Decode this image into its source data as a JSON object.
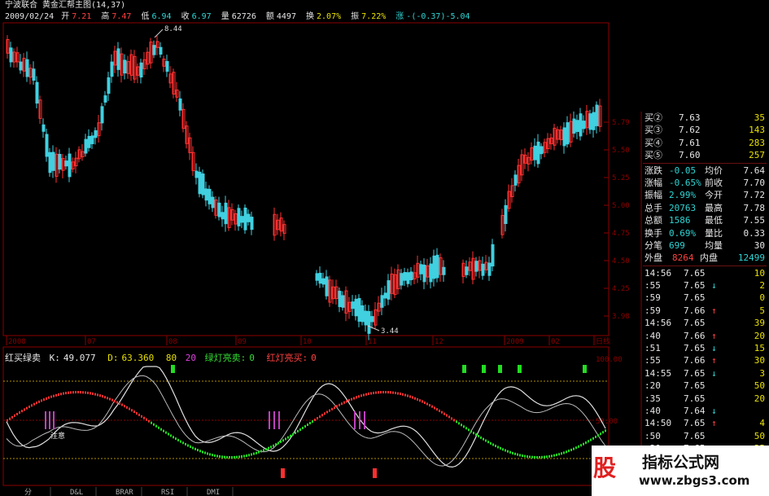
{
  "header": {
    "stock_name": "宁波联合",
    "chart_title": "黄金汇帮主图(14,37)",
    "date": "2009/02/24",
    "open_label": "开",
    "open": "7.21",
    "high_label": "高",
    "high": "7.47",
    "low_label": "低",
    "low": "6.94",
    "close_label": "收",
    "close": "6.97",
    "volume_label": "量",
    "volume": "62726",
    "amount_label": "额",
    "amount": "4497",
    "turnover_label": "换",
    "turnover": "2.07%",
    "amplitude_label": "振",
    "amplitude": "7.22%",
    "change_label": "涨",
    "change": "-(-0.37)-5.04"
  },
  "main_chart": {
    "y_ticks": [
      "5.79",
      "5.50",
      "5.25",
      "5.00",
      "4.75",
      "4.50",
      "4.25",
      "3.98"
    ],
    "high_annotation": "8.44",
    "low_annotation": "3.44",
    "x_ticks": [
      "2008",
      "07",
      "08",
      "09",
      "10",
      "11",
      "12",
      "2009",
      "02",
      "日线"
    ]
  },
  "indicator": {
    "name": "红买绿卖",
    "k_label": "K:",
    "k_value": "49.077",
    "d_label": "D:",
    "d_value": "63.360",
    "v80": "80",
    "v20": "20",
    "green_label": "绿灯亮卖:",
    "green_value": "0",
    "red_label": "红灯亮买:",
    "red_value": "0",
    "y_ticks": [
      "100.00",
      "50.00"
    ],
    "attention": "注意",
    "bottom_tabs": [
      "分",
      "D&L",
      "BRAR",
      "RSI",
      "DMI"
    ]
  },
  "colors": {
    "up": "#ff3030",
    "down": "#40d0e0",
    "grid": "#8b0000",
    "green": "#22dd22",
    "purple": "#c040c0"
  },
  "panel": {
    "bids": [
      {
        "label": "买②",
        "price": "7.63",
        "vol": "35"
      },
      {
        "label": "买③",
        "price": "7.62",
        "vol": "143"
      },
      {
        "label": "买④",
        "price": "7.61",
        "vol": "283"
      },
      {
        "label": "买⑤",
        "price": "7.60",
        "vol": "257"
      }
    ],
    "stats": [
      {
        "l1": "涨跌",
        "v1": "-0.05",
        "l2": "均价",
        "v2": "7.64"
      },
      {
        "l1": "涨幅",
        "v1": "-0.65%",
        "l2": "前收",
        "v2": "7.70"
      },
      {
        "l1": "振幅",
        "v1": "2.99%",
        "l2": "今开",
        "v2": "7.72"
      },
      {
        "l1": "总手",
        "v1": "20763",
        "l2": "最高",
        "v2": "7.78"
      },
      {
        "l1": "总额",
        "v1": "1586",
        "l2": "最低",
        "v2": "7.55"
      },
      {
        "l1": "换手",
        "v1": "0.69%",
        "l2": "量比",
        "v2": "0.33"
      },
      {
        "l1": "分笔",
        "v1": "699",
        "l2": "均量",
        "v2": "30"
      }
    ],
    "outer_label": "外盘",
    "outer": "8264",
    "inner_label": "内盘",
    "inner": "12499",
    "ticks": [
      {
        "time": "14:56",
        "price": "7.65",
        "arrow": "",
        "vol": "10"
      },
      {
        "time": ":55",
        "price": "7.65",
        "arrow": "↓",
        "vol": "2"
      },
      {
        "time": ":59",
        "price": "7.65",
        "arrow": "",
        "vol": "0"
      },
      {
        "time": ":59",
        "price": "7.66",
        "arrow": "↑",
        "vol": "5"
      },
      {
        "time": "14:56",
        "price": "7.65",
        "arrow": "",
        "vol": "39"
      },
      {
        "time": ":40",
        "price": "7.66",
        "arrow": "↑",
        "vol": "20"
      },
      {
        "time": ":51",
        "price": "7.65",
        "arrow": "↓",
        "vol": "15"
      },
      {
        "time": ":55",
        "price": "7.66",
        "arrow": "↑",
        "vol": "30"
      },
      {
        "time": "14:55",
        "price": "7.65",
        "arrow": "↓",
        "vol": "3"
      },
      {
        "time": ":20",
        "price": "7.65",
        "arrow": "",
        "vol": "50"
      },
      {
        "time": ":35",
        "price": "7.65",
        "arrow": "",
        "vol": "20"
      },
      {
        "time": ":40",
        "price": "7.64",
        "arrow": "↓",
        "vol": ""
      },
      {
        "time": "14:50",
        "price": "7.65",
        "arrow": "↑",
        "vol": "4"
      },
      {
        "time": ":50",
        "price": "7.65",
        "arrow": "",
        "vol": "50"
      },
      {
        "time": ":20",
        "price": "7.65",
        "arrow": "↑",
        "vol": "25"
      },
      {
        "time": ":20",
        "price": "7.65",
        "arrow": "↑",
        "vol": "70"
      }
    ]
  },
  "watermark": {
    "logo": "股",
    "name": "指标公式网",
    "url": "www.zbgs3.com"
  }
}
